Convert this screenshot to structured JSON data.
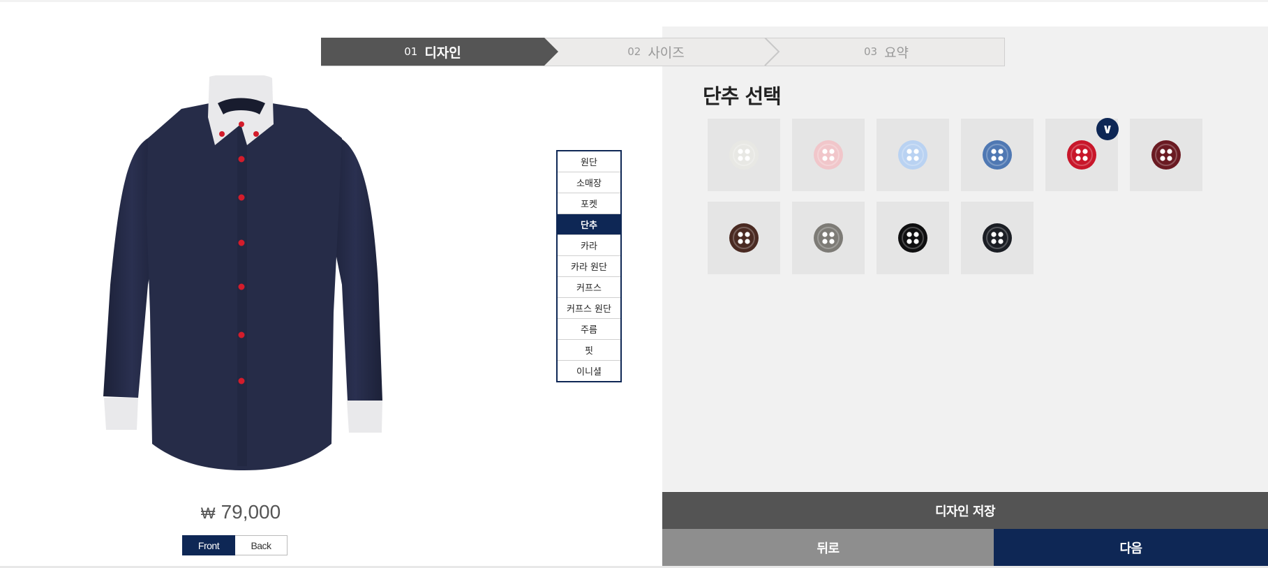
{
  "stepper": {
    "steps": [
      {
        "num": "01",
        "label": "디자인",
        "active": true
      },
      {
        "num": "02",
        "label": "사이즈",
        "active": false
      },
      {
        "num": "03",
        "label": "요약",
        "active": false
      }
    ]
  },
  "product": {
    "currency": "₩",
    "price": "79,000",
    "view_front": "Front",
    "view_back": "Back",
    "active_view": "Front"
  },
  "options_menu": {
    "items": [
      "원단",
      "소매장",
      "포켓",
      "단추",
      "카라",
      "카라 원단",
      "커프스",
      "커프스 원단",
      "주름",
      "핏",
      "이니셜"
    ],
    "selected": "단추"
  },
  "button_panel": {
    "title": "단추 선택",
    "selected_index": 4,
    "swatches": [
      {
        "color": "#e8e8e4",
        "hole": "#ffffff"
      },
      {
        "color": "#f1c6ca",
        "hole": "#ffffff"
      },
      {
        "color": "#b9d2f2",
        "hole": "#ffffff"
      },
      {
        "color": "#4f78b3",
        "hole": "#ffffff"
      },
      {
        "color": "#c8162a",
        "hole": "#ffffff"
      },
      {
        "color": "#6a1a22",
        "hole": "#ffffff"
      },
      {
        "color": "#4a2a22",
        "hole": "#ffffff"
      },
      {
        "color": "#7d7b76",
        "hole": "#ffffff"
      },
      {
        "color": "#0f0f10",
        "hole": "#ffffff"
      },
      {
        "color": "#1b1e24",
        "hole": "#ffffff"
      }
    ]
  },
  "actions": {
    "save": "디자인 저장",
    "back": "뒤로",
    "next": "다음"
  },
  "colors": {
    "accent": "#0e2755",
    "shirt_body": "#242a44",
    "collar": "#e9e9eb",
    "shirt_button": "#d31c2b"
  }
}
